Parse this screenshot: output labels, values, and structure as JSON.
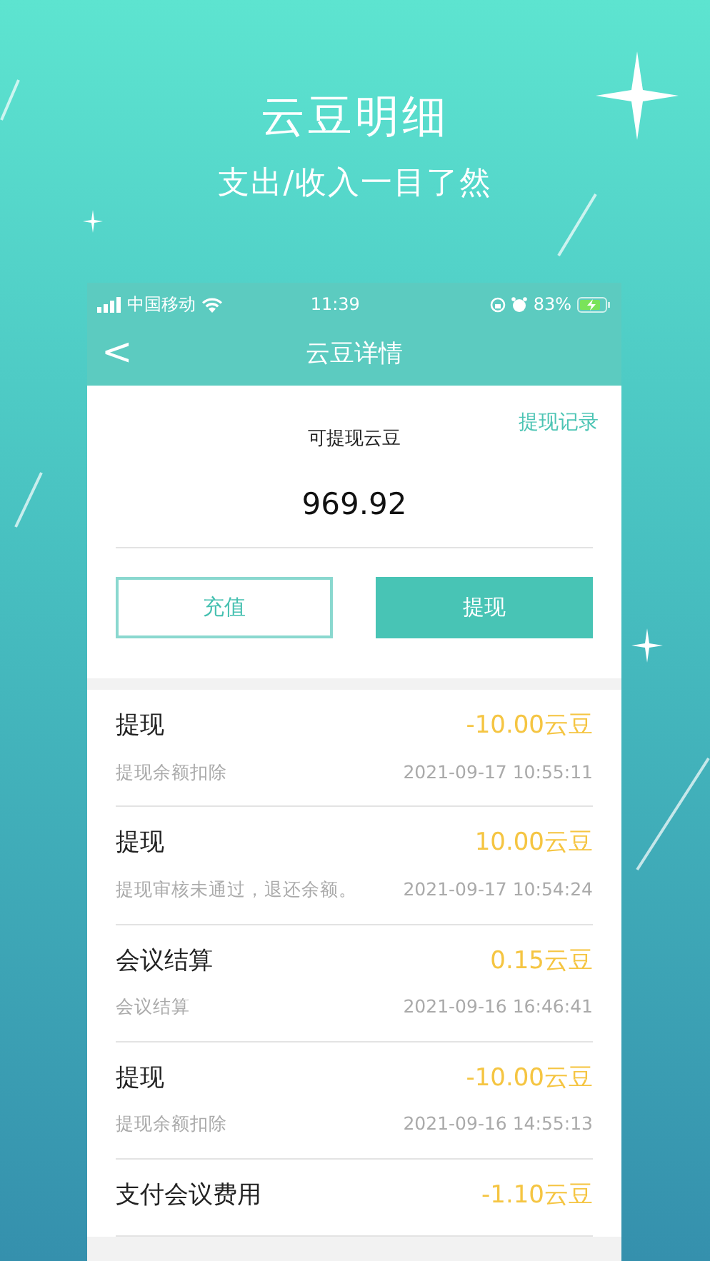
{
  "headline": "云豆明细",
  "tagline": "支出/收入一目了然",
  "status_bar": {
    "carrier": "中国移动",
    "time": "11:39",
    "battery": "83%"
  },
  "nav": {
    "back": "<",
    "title": "云豆详情"
  },
  "balance": {
    "link": "提现记录",
    "label": "可提现云豆",
    "amount": "969.92"
  },
  "buttons": [
    {
      "label": "充值",
      "kind": "outline"
    },
    {
      "label": "提现",
      "kind": "filled"
    }
  ],
  "records": [
    {
      "title": "提现",
      "amount": "-10.00云豆",
      "note": "提现余额扣除",
      "time": "2021-09-17 10:55:11"
    },
    {
      "title": "提现",
      "amount": "10.00云豆",
      "note": "提现审核未通过，退还余额。",
      "time": "2021-09-17 10:54:24"
    },
    {
      "title": "会议结算",
      "amount": "0.15云豆",
      "note": "会议结算",
      "time": "2021-09-16 16:46:41"
    },
    {
      "title": "提现",
      "amount": "-10.00云豆",
      "note": "提现余额扣除",
      "time": "2021-09-16 14:55:13"
    },
    {
      "title": "支付会议费用",
      "amount": "-1.10云豆"
    }
  ]
}
